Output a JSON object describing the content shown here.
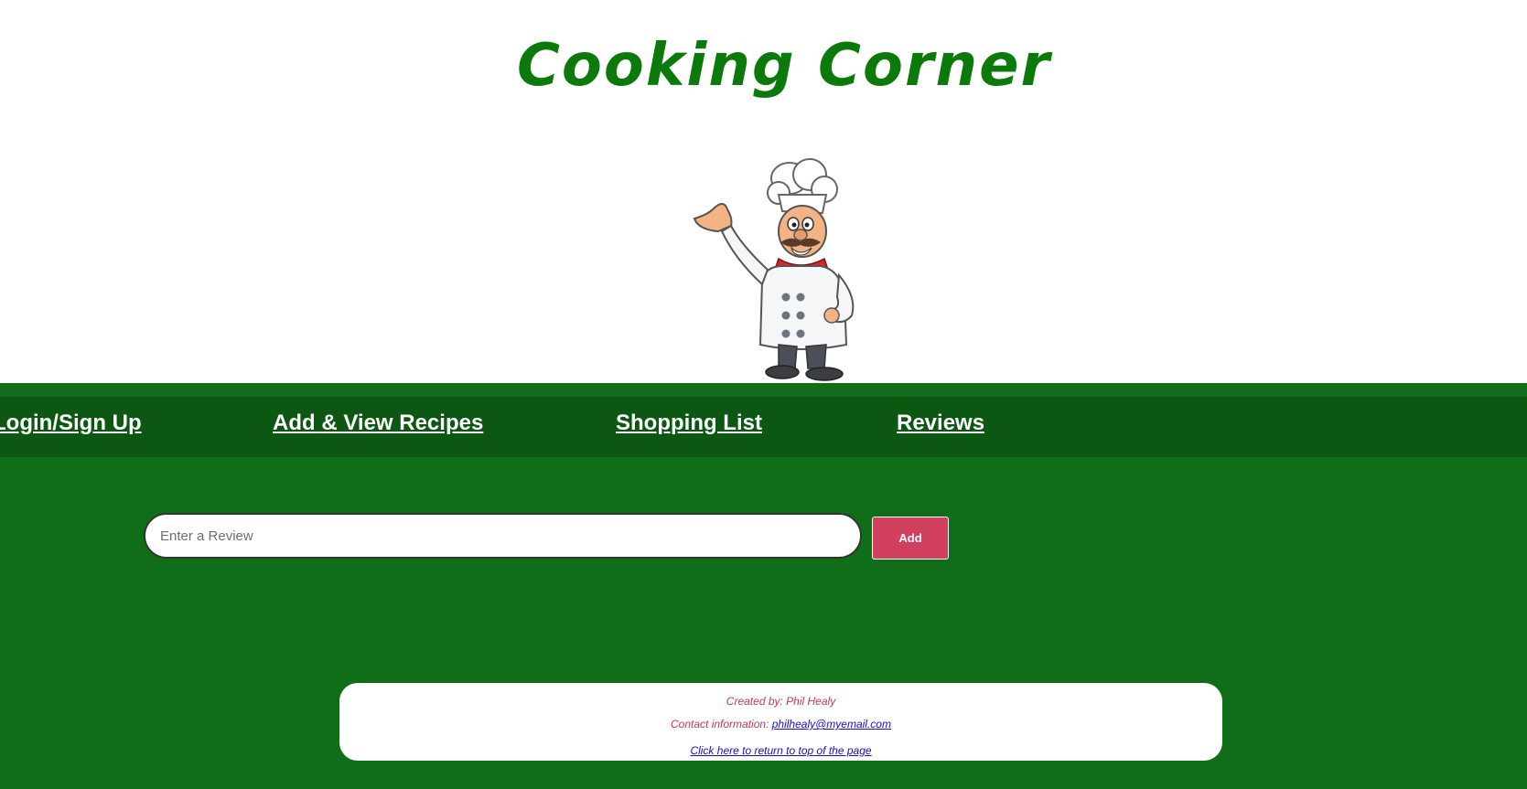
{
  "header": {
    "title": "Cooking Corner",
    "logo_icon": "chef-mascot-icon"
  },
  "nav": {
    "items": [
      {
        "label": "Login/Sign Up"
      },
      {
        "label": "Add & View Recipes"
      },
      {
        "label": "Shopping List"
      },
      {
        "label": "Reviews"
      }
    ]
  },
  "review": {
    "placeholder": "Enter a Review",
    "add_label": "Add"
  },
  "footer": {
    "created_by": "Created by: Phil Healy",
    "contact_label": "Contact information:",
    "contact_email": "philhealy@myemail.com",
    "back_to_top": "Click here to return to top of the page"
  },
  "colors": {
    "page_background": "#116e18",
    "nav_background": "#0c5712",
    "title": "#0b7a0b",
    "add_button": "#d1405f",
    "footer_text": "#c2385a",
    "link": "#1a0dcc"
  }
}
